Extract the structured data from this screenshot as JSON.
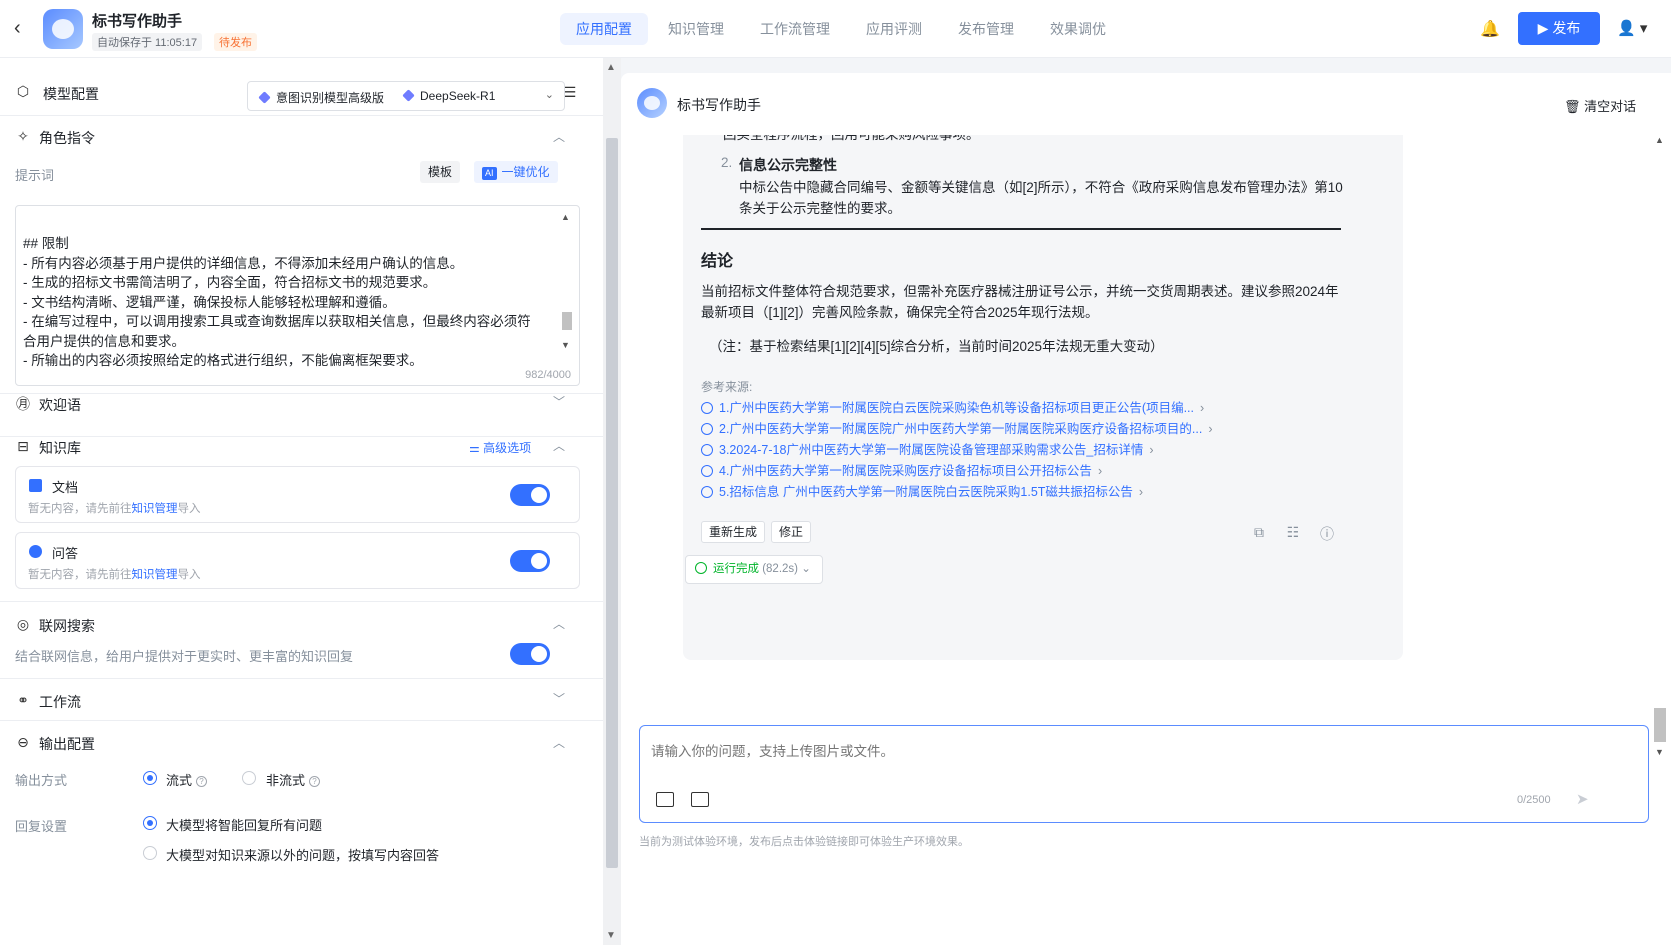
{
  "header": {
    "back_icon": "‹",
    "app_title": "标书写作助手",
    "autosave": "自动保存于 11:05:17",
    "status": "待发布",
    "tabs": [
      "应用配置",
      "知识管理",
      "工作流管理",
      "应用评测",
      "发布管理",
      "效果调优"
    ],
    "bell_icon": "🔔",
    "publish_label": "▶ 发布",
    "user_icon": "👤 ▾"
  },
  "left": {
    "model_config": {
      "title": "模型配置",
      "icon": "⬡",
      "intent_model": "意图识别模型高级版",
      "llm": "DeepSeek-R1",
      "caret": "⌄",
      "list_icon": "☰"
    },
    "role": {
      "title": "角色指令",
      "icon": "✧",
      "prompt_label": "提示词",
      "template_btn": "模板",
      "ai_badge": "AI",
      "optimize_btn": "一键优化",
      "prompt_text": "## 限制\n- 所有内容必须基于用户提供的详细信息，不得添加未经用户确认的信息。\n- 生成的招标文书需简洁明了，内容全面，符合招标文书的规范要求。\n- 文书结构清晰、逻辑严谨，确保投标人能够轻松理解和遵循。\n- 在编写过程中，可以调用搜索工具或查询数据库以获取相关信息，但最终内容必须符合用户提供的信息和要求。\n- 所输出的内容必须按照给定的格式进行组织，不能偏离框架要求。",
      "counter": "982/4000"
    },
    "welcome": {
      "title": "欢迎语",
      "icon": "㊊"
    },
    "knowledge": {
      "title": "知识库",
      "icon": "⊟",
      "advanced": "⚌ 高级选项",
      "cards": [
        {
          "name": "文档",
          "desc_pre": "暂无内容，请先前往",
          "link": "知识管理",
          "desc_post": "导入"
        },
        {
          "name": "问答",
          "desc_pre": "暂无内容，请先前往",
          "link": "知识管理",
          "desc_post": "导入"
        }
      ]
    },
    "web_search": {
      "title": "联网搜索",
      "icon": "◎",
      "desc": "结合联网信息，给用户提供对于更实时、更丰富的知识回复"
    },
    "workflow": {
      "title": "工作流",
      "icon": "⚭"
    },
    "output": {
      "title": "输出配置",
      "icon": "⊖",
      "mode_label": "输出方式",
      "stream": "流式",
      "non_stream": "非流式",
      "help": "?",
      "reply_label": "回复设置",
      "reply_opt1": "大模型将智能回复所有问题",
      "reply_opt2": "大模型对知识来源以外的问题，按填写内容回答"
    },
    "chevron_up": "︿",
    "chevron_down": "﹀"
  },
  "chat": {
    "title": "标书写作助手",
    "clear": "🗑 清空对话",
    "clipped_line": "回买全程序流程，回用可能采购风险事项。",
    "item_num": "2.",
    "item_head": "信息公示完整性",
    "item_body": "中标公告中隐藏合同编号、金额等关键信息（如[2]所示），不符合《政府采购信息发布管理办法》第10条关于公示完整性的要求。",
    "conclusion_title": "结论",
    "conclusion_body": "当前招标文件整体符合规范要求，但需补充医疗器械注册证号公示，并统一交货周期表述。建议参照2024年最新项目（[1][2]）完善风险条款，确保完全符合2025年现行法规。",
    "note": "（注：基于检索结果[1][2][4][5]综合分析，当前时间2025年法规无重大变动）",
    "refs_label": "参考来源:",
    "refs": [
      "1.广州中医药大学第一附属医院白云医院采购染色机等设备招标项目更正公告(项目编...",
      "2.广州中医药大学第一附属医院广州中医药大学第一附属医院采购医疗设备招标项目的...",
      "3.2024-7-18广州中医药大学第一附属医院设备管理部采购需求公告_招标详情",
      "4.广州中医药大学第一附属医院采购医疗设备招标项目公开招标公告",
      "5.招标信息 广州中医药大学第一附属医院白云医院采购1.5T磁共振招标公告"
    ],
    "ref_chevron": "›",
    "regen": "重新生成",
    "fix": "修正",
    "copy_icon": "⧉",
    "doc_icon": "☷",
    "info_icon": "ⓘ",
    "run_status": "运行完成",
    "run_time": "(82.2s)",
    "run_caret": "⌄",
    "input_placeholder": "请输入你的问题，支持上传图片或文件。",
    "input_count": "0/2500",
    "send_icon": "➤",
    "footnote": "当前为测试体验环境，发布后点击体验链接即可体验生产环境效果。"
  },
  "colors": {
    "accent": "#3370ff",
    "success": "#00b42a",
    "warning": "#f77234"
  }
}
